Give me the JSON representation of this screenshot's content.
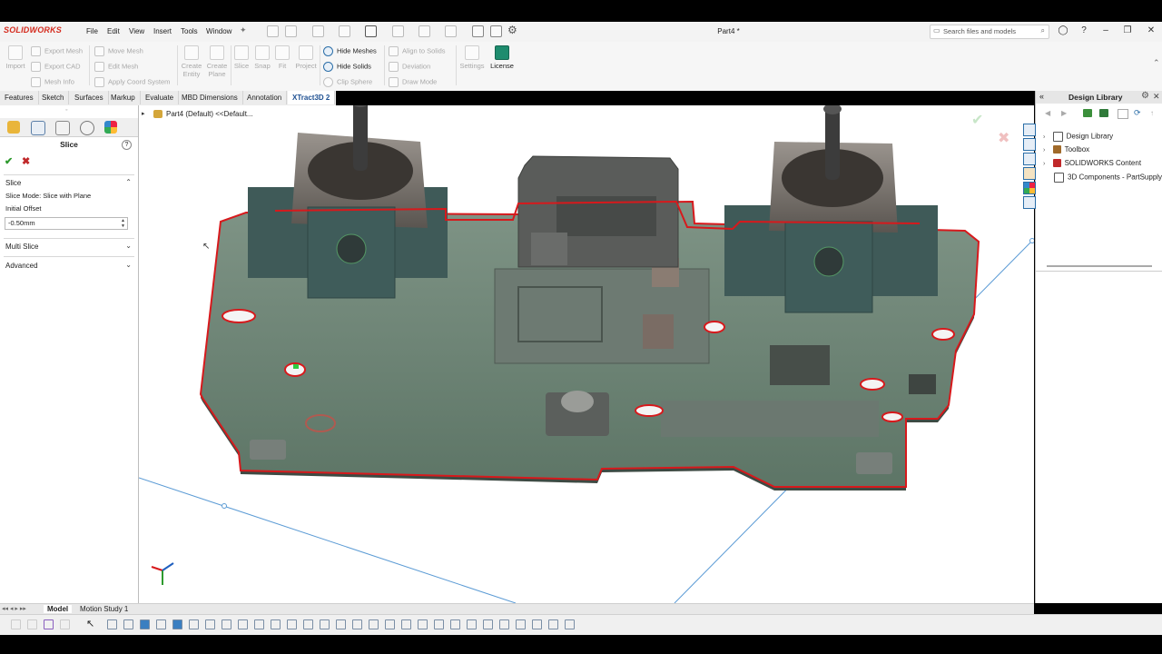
{
  "app": {
    "logo": "SOLIDWORKS",
    "document_title": "Part4 *"
  },
  "menu": [
    "File",
    "Edit",
    "View",
    "Insert",
    "Tools",
    "Window"
  ],
  "search": {
    "placeholder": "Search files and models"
  },
  "command_manager": {
    "group1": [
      "Export Mesh",
      "Export CAD",
      "Mesh Info"
    ],
    "import_label": "Import",
    "group2": [
      "Move Mesh",
      "Edit Mesh",
      "Apply Coord System"
    ],
    "group3": [
      "Create Entity",
      "Create Plane"
    ],
    "group4": [
      "Slice",
      "Snap",
      "Fit",
      "Project"
    ],
    "group5": [
      "Hide Meshes",
      "Hide Solids",
      "Clip Sphere"
    ],
    "group6": [
      "Align to Solids",
      "Deviation",
      "Draw Mode"
    ],
    "settings_label": "Settings",
    "license_label": "License"
  },
  "tabs": [
    "Features",
    "Sketch",
    "Surfaces",
    "Markup",
    "Evaluate",
    "MBD Dimensions",
    "Annotation",
    "XTract3D 2"
  ],
  "active_tab": "XTract3D 2",
  "property_manager": {
    "title": "Slice",
    "help": "?",
    "section_slice": "Slice",
    "slice_mode": "Slice Mode: Slice with Plane",
    "initial_offset_label": "Initial Offset",
    "initial_offset_value": "-0.50mm",
    "section_multi": "Multi Slice",
    "section_advanced": "Advanced"
  },
  "feature_tree": {
    "root": "Part4 (Default) <<Default..."
  },
  "design_library": {
    "title": "Design Library",
    "items": [
      "Design Library",
      "Toolbox",
      "SOLIDWORKS Content",
      "3D Components - PartSupply"
    ]
  },
  "bottom_tabs": [
    "Model",
    "Motion Study 1"
  ],
  "colors": {
    "accent": "#1d4f91",
    "slice_outline": "#d7191c",
    "pcb": "#5f7a6c",
    "brand": "#d52b1e"
  }
}
